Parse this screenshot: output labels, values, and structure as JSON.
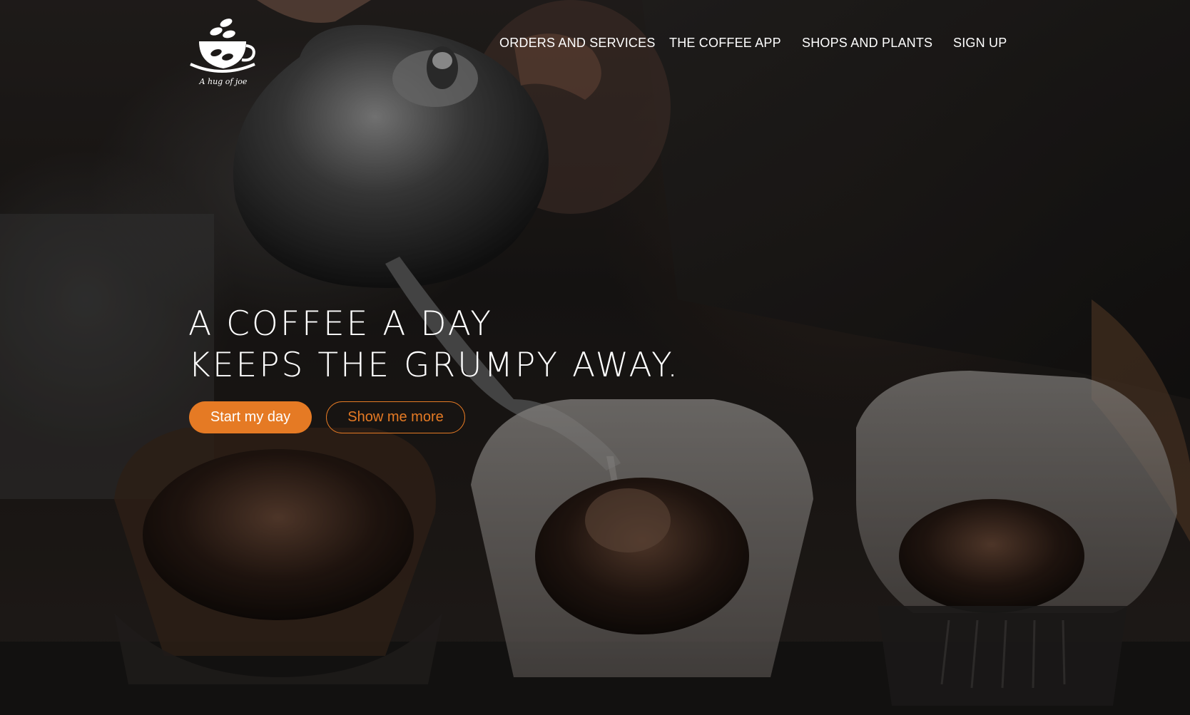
{
  "brand": {
    "logo_icon": "coffee-cup-icon",
    "logo_script": "A hug of joe"
  },
  "nav": {
    "items": [
      {
        "label": "ORDERS AND SERVICES"
      },
      {
        "label": "THE COFFEE APP"
      },
      {
        "label": "SHOPS AND PLANTS"
      },
      {
        "label": "SIGN UP"
      }
    ]
  },
  "hero": {
    "headline_line1": "A COFFEE A DAY",
    "headline_line2": "KEEPS THE GRUMPY AWAY.",
    "primary_button": "Start my day",
    "secondary_button": "Show me more"
  },
  "colors": {
    "accent": "#e57a24",
    "text": "#ffffff",
    "overlay": "#141414"
  }
}
